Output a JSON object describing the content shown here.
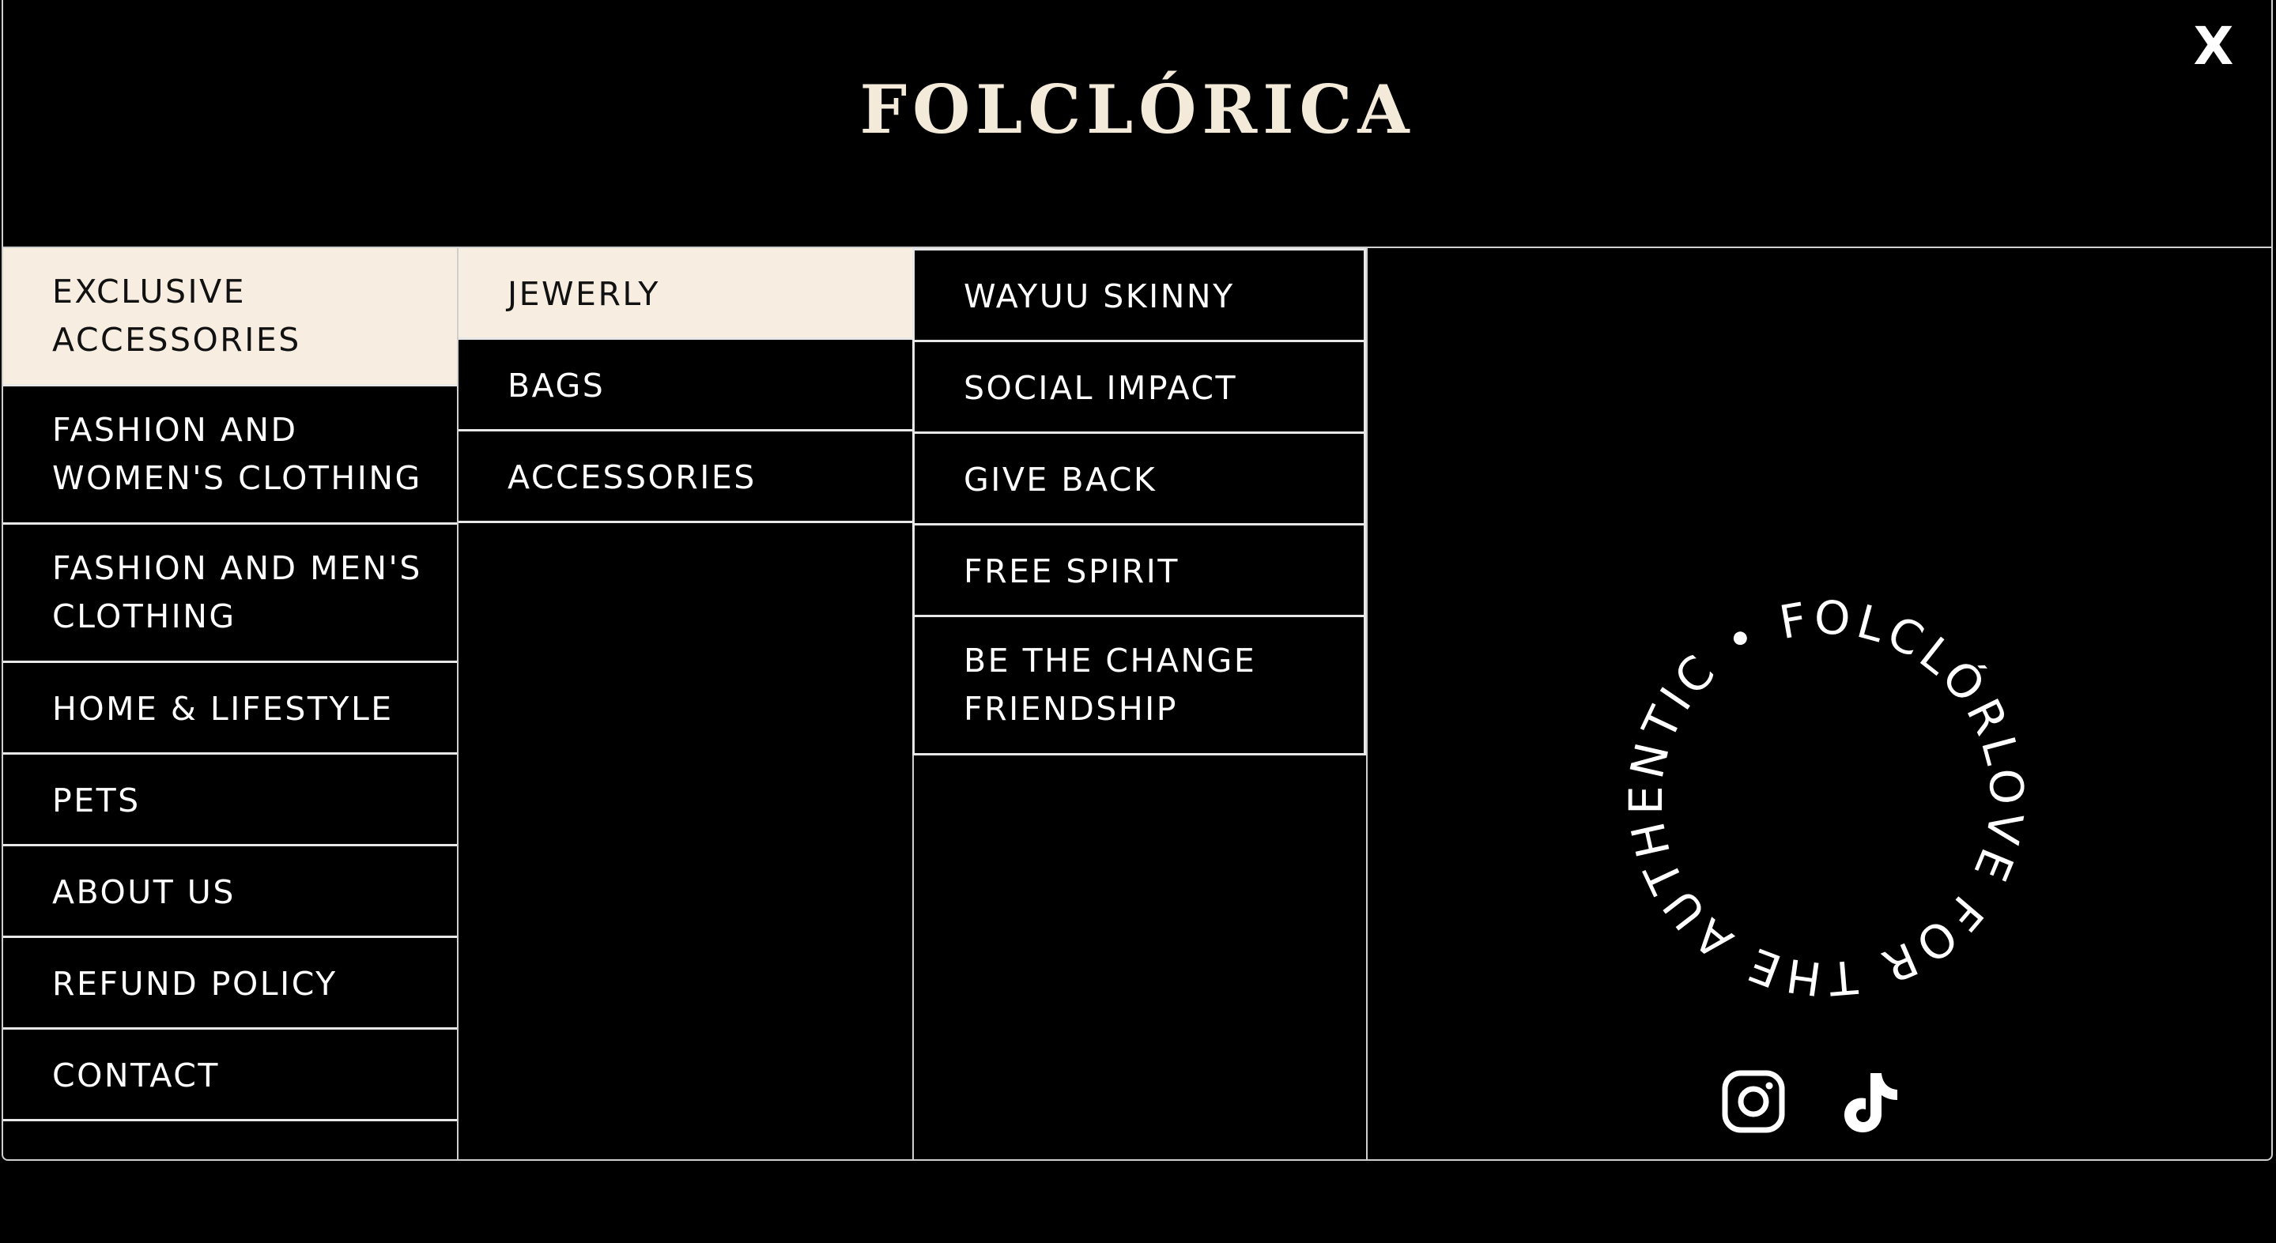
{
  "brand": {
    "logo_text": "FOLCLÓRICA"
  },
  "close_label": "X",
  "primary_menu": [
    {
      "label": "EXCLUSIVE ACCESSORIES",
      "active": true
    },
    {
      "label": "FASHION AND WOMEN'S CLOTHING",
      "active": false
    },
    {
      "label": "FASHION AND MEN'S CLOTHING",
      "active": false
    },
    {
      "label": "HOME & LIFESTYLE",
      "active": false
    },
    {
      "label": "PETS",
      "active": false
    },
    {
      "label": "ABOUT US",
      "active": false
    },
    {
      "label": "REFUND POLICY",
      "active": false
    },
    {
      "label": "CONTACT",
      "active": false
    }
  ],
  "secondary_menu": [
    {
      "label": "JEWERLY",
      "active": true
    },
    {
      "label": "BAGS",
      "active": false
    },
    {
      "label": "ACCESSORIES",
      "active": false
    }
  ],
  "tertiary_menu": [
    {
      "label": "WAYUU SKINNY"
    },
    {
      "label": "SOCIAL IMPACT"
    },
    {
      "label": "GIVE BACK"
    },
    {
      "label": "FREE SPIRIT"
    },
    {
      "label": "BE THE CHANGE FRIENDSHIP"
    }
  ],
  "badge": {
    "text": "LOVE FOR THE AUTHENTIC • FOLCLÓRICA •"
  },
  "social": [
    {
      "name": "instagram-icon"
    },
    {
      "name": "tiktok-icon"
    }
  ],
  "colors": {
    "background": "#000000",
    "active_item": "#f7ede1",
    "logo": "#f3ead9",
    "text": "#ffffff",
    "divider": "#e8e8e8"
  }
}
